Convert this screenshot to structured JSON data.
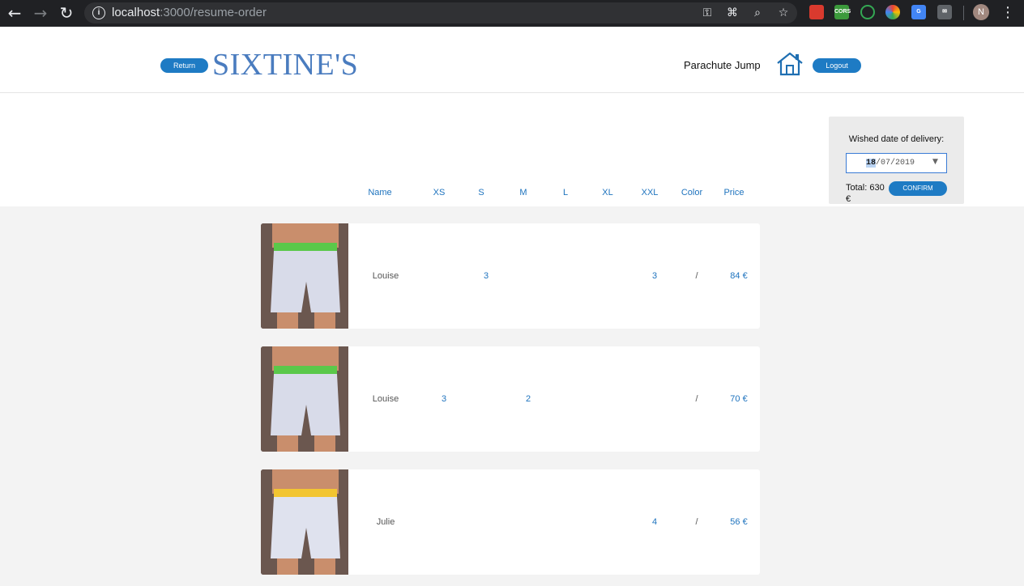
{
  "browser": {
    "url_host": "localhost",
    "url_path": ":3000/resume-order"
  },
  "header": {
    "return_label": "Return",
    "logo": "SIXTINE'S",
    "user": "Parachute Jump",
    "logout_label": "Logout"
  },
  "columns": [
    "Name",
    "XS",
    "S",
    "M",
    "L",
    "XL",
    "XXL",
    "Color",
    "Price"
  ],
  "delivery": {
    "label": "Wished date of delivery:",
    "date_day": "18",
    "date_rest": "/07/2019",
    "total": "Total: 630 €",
    "confirm_label": "CONFIRM"
  },
  "orders": [
    {
      "name": "Louise",
      "xs": "",
      "s": "3",
      "m": "",
      "l": "",
      "xl": "",
      "xxl": "3",
      "color": "/",
      "price": "84 €",
      "band_color": "#5ac84a"
    },
    {
      "name": "Louise",
      "xs": "3",
      "s": "",
      "m": "2",
      "l": "",
      "xl": "",
      "xxl": "",
      "color": "/",
      "price": "70 €",
      "band_color": "#5ac84a"
    },
    {
      "name": "Julie",
      "xs": "",
      "s": "",
      "m": "",
      "l": "",
      "xl": "",
      "xxl": "4",
      "color": "/",
      "price": "56 €",
      "band_color": "#f2c531"
    }
  ],
  "colors": {
    "accent": "#1e7bc4",
    "link": "#1e73be",
    "logo": "#4a7cbf"
  }
}
